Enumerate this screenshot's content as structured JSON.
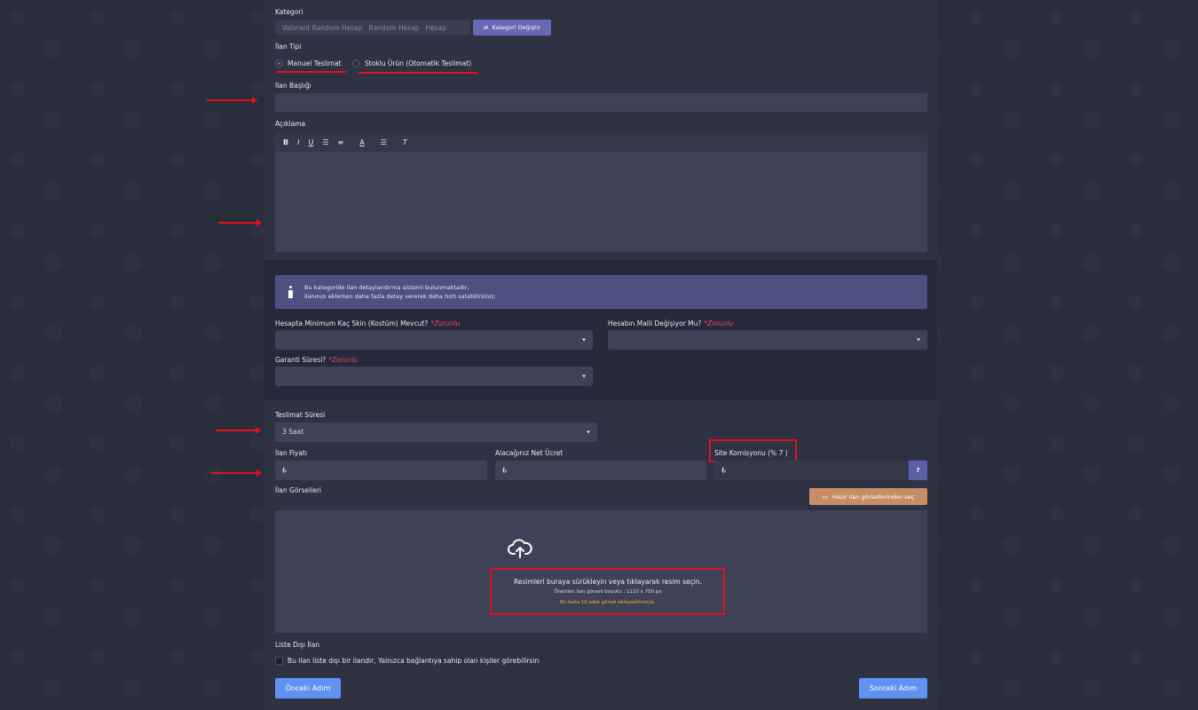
{
  "category": {
    "label": "Kategori",
    "path": [
      "Valorant Random Hesap",
      "Random Hesap",
      "Hesap"
    ],
    "change_button": "Kategori Değiştir",
    "change_icon": "swap-icon"
  },
  "listing_type": {
    "label": "İlan Tipi",
    "options": [
      {
        "label": "Manuel Teslimat",
        "selected": true
      },
      {
        "label": "Stoklu Ürün (Otomatik Teslimat)",
        "selected": false
      }
    ]
  },
  "title_field": {
    "label": "İlan Başlığı",
    "value": ""
  },
  "description": {
    "label": "Açıklama",
    "toolbar": [
      "B",
      "I",
      "U",
      "ordered-list-icon",
      "bullet-list-icon",
      "text-color-icon",
      "align-icon",
      "clear-format-icon"
    ]
  },
  "info": {
    "line1": "Bu kategoride ilan detaylandırma sistemi bulunmaktadır,",
    "line2": "ilanınızı eklerken daha fazla detay vererek daha hızlı satabilirsiniz."
  },
  "details": {
    "required_text": "*Zorunlu",
    "fields": [
      {
        "label": "Hesapta Minimum Kaç Skin (Kostüm) Mevcut?",
        "value": ""
      },
      {
        "label": "Hesabın Maili Değişiyor Mu?",
        "value": ""
      },
      {
        "label": "Garanti Süresi?",
        "value": ""
      }
    ]
  },
  "delivery": {
    "label": "Teslimat Süresi",
    "value": "3 Saat"
  },
  "pricing": {
    "currency_symbol": "₺",
    "price_label": "İlan Fiyatı",
    "net_label": "Alacağınız Net Ücret",
    "commission_label": "Site Komisyonu (% 7 )",
    "help": "?"
  },
  "images": {
    "label": "İlan Görselleri",
    "ready_button": "Hazır ilan görsellerinden seç",
    "ready_icon": "images-icon",
    "upload_icon": "cloud-upload-icon",
    "drop_text": "Resimleri buraya sürükleyin veya tıklayarak resim seçin.",
    "size_hint": "Önerilen ilan görseli boyutu : 1110 x 750 px",
    "limit_hint": "En fazla 10 adet görsel ekleyebilirsiniz."
  },
  "unlisted": {
    "label": "Liste Dışı İlan",
    "checkbox_text": "Bu ilan liste dışı bir ilandır, Yalnızca bağlantıya sahip olan kişiler görebilirsin",
    "checked": false
  },
  "nav": {
    "prev": "Önceki Adım",
    "next": "Sonraki Adım"
  },
  "colors": {
    "accent": "#6669b6",
    "annotation": "#e3101d",
    "primary_button": "#5f93f1",
    "warning_text": "#f0b429"
  }
}
